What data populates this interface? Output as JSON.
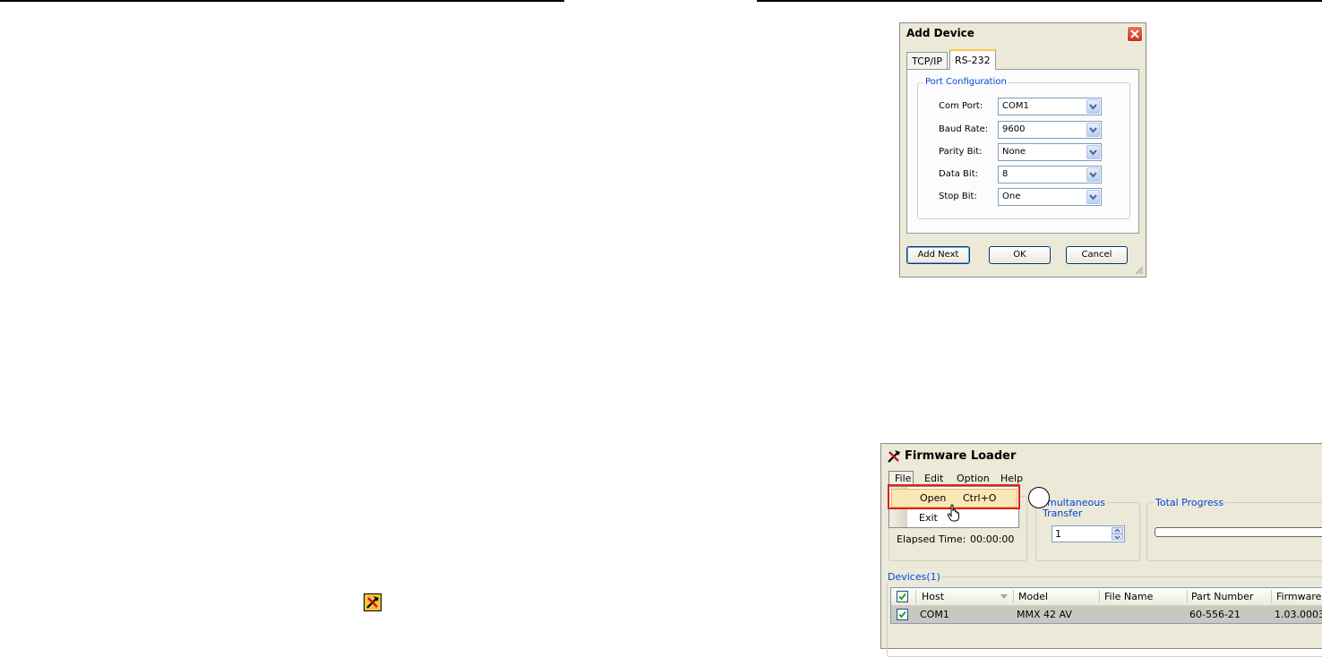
{
  "add_device_dialog": {
    "title": "Add Device",
    "tabs": [
      {
        "label": "TCP/IP",
        "active": false
      },
      {
        "label": "RS-232",
        "active": true
      }
    ],
    "group_title": "Port Configuration",
    "fields": [
      {
        "label": "Com Port:",
        "value": "COM1"
      },
      {
        "label": "Baud Rate:",
        "value": "9600"
      },
      {
        "label": "Parity Bit:",
        "value": "None"
      },
      {
        "label": "Data Bit:",
        "value": "8"
      },
      {
        "label": "Stop Bit:",
        "value": "One"
      }
    ],
    "buttons": {
      "add_next": "Add Next",
      "ok": "OK",
      "cancel": "Cancel"
    }
  },
  "firmware_loader": {
    "title": "Firmware Loader",
    "menu": [
      "File",
      "Edit",
      "Option",
      "Help"
    ],
    "file_menu": {
      "open_label": "Open",
      "open_shortcut": "Ctrl+O",
      "exit_label": "Exit"
    },
    "simultaneous_legend_visible": "multaneous",
    "simultaneous_sub": "Transfer",
    "transfer_count": "1",
    "total_progress_legend": "Total Progress",
    "elapsed_label": "Elapsed Time:",
    "elapsed_value": "00:00:00",
    "devices_legend": "Devices(1)",
    "table": {
      "headers": [
        "Host",
        "Model",
        "File Name",
        "Part Number",
        "Firmware"
      ],
      "rows": [
        {
          "host": "COM1",
          "model": "MMX 42 AV",
          "file_name": "",
          "part_number": "60-556-21",
          "firmware": "1.03.0003"
        }
      ]
    }
  },
  "colors": {
    "dialog_bg": "#ece9d8",
    "highlight_border": "#e0201e",
    "group_legend": "#0046d5",
    "menu_highlight": "#fbe7b6"
  }
}
